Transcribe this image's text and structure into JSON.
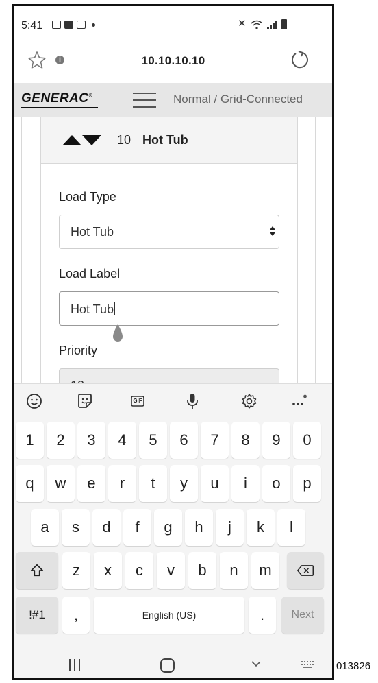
{
  "status_bar": {
    "time": "5:41"
  },
  "browser": {
    "url": "10.10.10.10",
    "info_icon": "i"
  },
  "header": {
    "brand": "GENERAC",
    "brand_mark": "®",
    "mode": "Normal / Grid-Connected"
  },
  "load_card": {
    "number": "10",
    "name": "Hot Tub",
    "load_type_label": "Load Type",
    "load_type_value": "Hot Tub",
    "load_label_label": "Load Label",
    "load_label_value": "Hot Tub",
    "priority_label": "Priority",
    "priority_value": "10"
  },
  "keyboard": {
    "toolbar_icons": [
      "emoji-icon",
      "sticker-icon",
      "gif-icon",
      "microphone-icon",
      "settings-icon",
      "more-icon"
    ],
    "gif_label": "GIF",
    "number_row": [
      "1",
      "2",
      "3",
      "4",
      "5",
      "6",
      "7",
      "8",
      "9",
      "0"
    ],
    "row1": [
      "q",
      "w",
      "e",
      "r",
      "t",
      "y",
      "u",
      "i",
      "o",
      "p"
    ],
    "row2": [
      "a",
      "s",
      "d",
      "f",
      "g",
      "h",
      "j",
      "k",
      "l"
    ],
    "row3": [
      "z",
      "x",
      "c",
      "v",
      "b",
      "n",
      "m"
    ],
    "symbols_label": "!#1",
    "comma_label": ",",
    "space_label": "English (US)",
    "period_label": ".",
    "next_label": "Next"
  },
  "figure_id": "013826"
}
